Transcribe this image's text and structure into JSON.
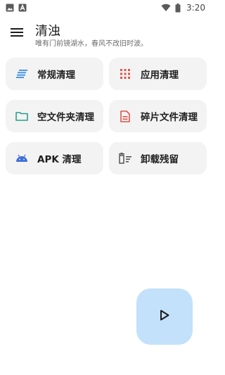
{
  "status_bar": {
    "time": "3:20",
    "left_icons": [
      "image-icon",
      "text-a-icon"
    ],
    "right_icons": [
      "wifi-icon",
      "battery-icon"
    ]
  },
  "app_bar": {
    "title": "清浊",
    "subtitle": "唯有门前镜湖水，春风不改旧时波。",
    "menu_icon": "menu-icon"
  },
  "actions": [
    {
      "label": "常规清理",
      "icon": "lines-icon",
      "color": "#3b8fe0"
    },
    {
      "label": "应用清理",
      "icon": "grid-icon",
      "color": "#e0554a"
    },
    {
      "label": "空文件夹清理",
      "icon": "folder-icon",
      "color": "#2a9d8f"
    },
    {
      "label": "碎片文件清理",
      "icon": "document-icon",
      "color": "#e0554a"
    },
    {
      "label": "APK 清理",
      "icon": "android-icon",
      "color": "#3f6fd8"
    },
    {
      "label": "卸载残留",
      "icon": "delete-sweep-icon",
      "color": "#555555"
    }
  ],
  "fab": {
    "icon": "play-icon",
    "background": "#c3e1fa"
  }
}
